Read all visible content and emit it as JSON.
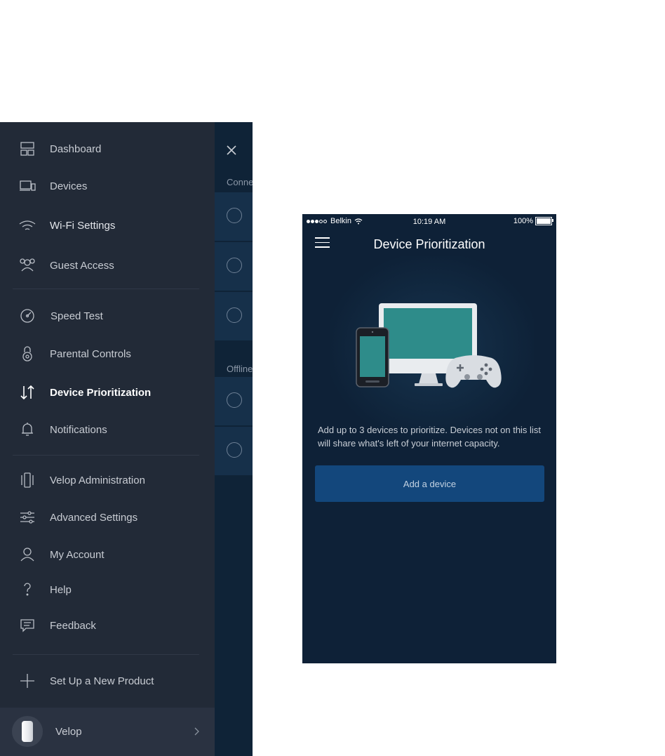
{
  "drawer": {
    "items": [
      {
        "label": "Dashboard",
        "icon": "dashboard-icon"
      },
      {
        "label": "Devices",
        "icon": "devices-icon"
      },
      {
        "label": "Wi-Fi Settings",
        "icon": "wifi-icon"
      },
      {
        "label": "Guest Access",
        "icon": "guest-access-icon"
      },
      {
        "label": "Speed Test",
        "icon": "speedometer-icon"
      },
      {
        "label": "Parental Controls",
        "icon": "lock-icon"
      },
      {
        "label": "Device Prioritization",
        "icon": "prioritization-arrows-icon",
        "active": true
      },
      {
        "label": "Notifications",
        "icon": "bell-icon"
      },
      {
        "label": "Velop Administration",
        "icon": "velop-node-icon"
      },
      {
        "label": "Advanced Settings",
        "icon": "sliders-icon"
      },
      {
        "label": "My Account",
        "icon": "user-icon"
      },
      {
        "label": "Help",
        "icon": "question-mark-icon"
      },
      {
        "label": "Feedback",
        "icon": "chat-bubble-icon"
      },
      {
        "label": "Set Up a New Product",
        "icon": "plus-icon"
      }
    ],
    "footer": {
      "label": "Velop"
    }
  },
  "background_page": {
    "section_connected": "Conne",
    "section_offline": "Offline"
  },
  "phone": {
    "status": {
      "carrier": "Belkin",
      "time": "10:19 AM",
      "battery": "100%"
    },
    "title": "Device Prioritization",
    "description": "Add up to 3 devices to prioritize. Devices not on this list will share what's left of your internet capacity.",
    "add_button": "Add a device"
  },
  "colors": {
    "drawer_bg": "#222a37",
    "screen_bg": "#0e2137",
    "button_bg": "#13477c",
    "monitor_screen": "#2e8c8a"
  }
}
